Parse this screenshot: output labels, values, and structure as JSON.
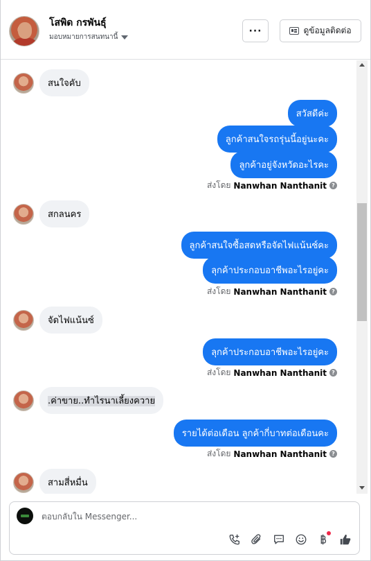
{
  "header": {
    "name": "โสพิด กรพันธุ์",
    "assign_label": "มอบหมายการสนทนานี้",
    "more_label": "···",
    "info_label": "ดูข้อมูลติดต่อ"
  },
  "messages": [
    {
      "dir": "in",
      "text": "สนใจคับ"
    },
    {
      "dir": "out",
      "text": "สวัสดีค่ะ"
    },
    {
      "dir": "out",
      "text": "ลูกค้าสนใจรถรุ่นนี้อยู่นะคะ"
    },
    {
      "dir": "out",
      "text": "ลูกค้าอยู่จังหวัดอะไรคะ"
    },
    {
      "dir": "in",
      "text": "สกลนคร"
    },
    {
      "dir": "out",
      "text": "ลูกค้าสนใจซื้อสดหรือจัดไฟแน้นซ์คะ"
    },
    {
      "dir": "out",
      "text": "ลุกค้าประกอบอาชีพอะไรอยู่คะ"
    },
    {
      "dir": "in",
      "text": "จัดไฟแน้นซ์"
    },
    {
      "dir": "out",
      "text": "ลุกค้าประกอบอาชีพอะไรอยู่คะ"
    },
    {
      "dir": "in",
      "text": ".ค่าขาย..ทำไรนาเลี้ยงควาย"
    },
    {
      "dir": "out",
      "text": "รายได้ต่อเดือน ลูกค้ากี่บาทต่อเดือนคะ"
    },
    {
      "dir": "in",
      "text": "สามสี่หมื่น"
    }
  ],
  "sent_by": {
    "prefix": "ส่งโดย",
    "agent": "Nanwhan Nanthanit",
    "help": "?"
  },
  "composer": {
    "placeholder": "ตอบกลับใน Messenger..."
  },
  "tools": [
    "add-call-icon",
    "attachment-icon",
    "saved-reply-icon",
    "emoji-icon",
    "payment-icon",
    "like-icon"
  ],
  "colors": {
    "accent": "#1877f2",
    "incoming_bubble": "#f0f2f5",
    "notification_dot": "#f02849"
  }
}
